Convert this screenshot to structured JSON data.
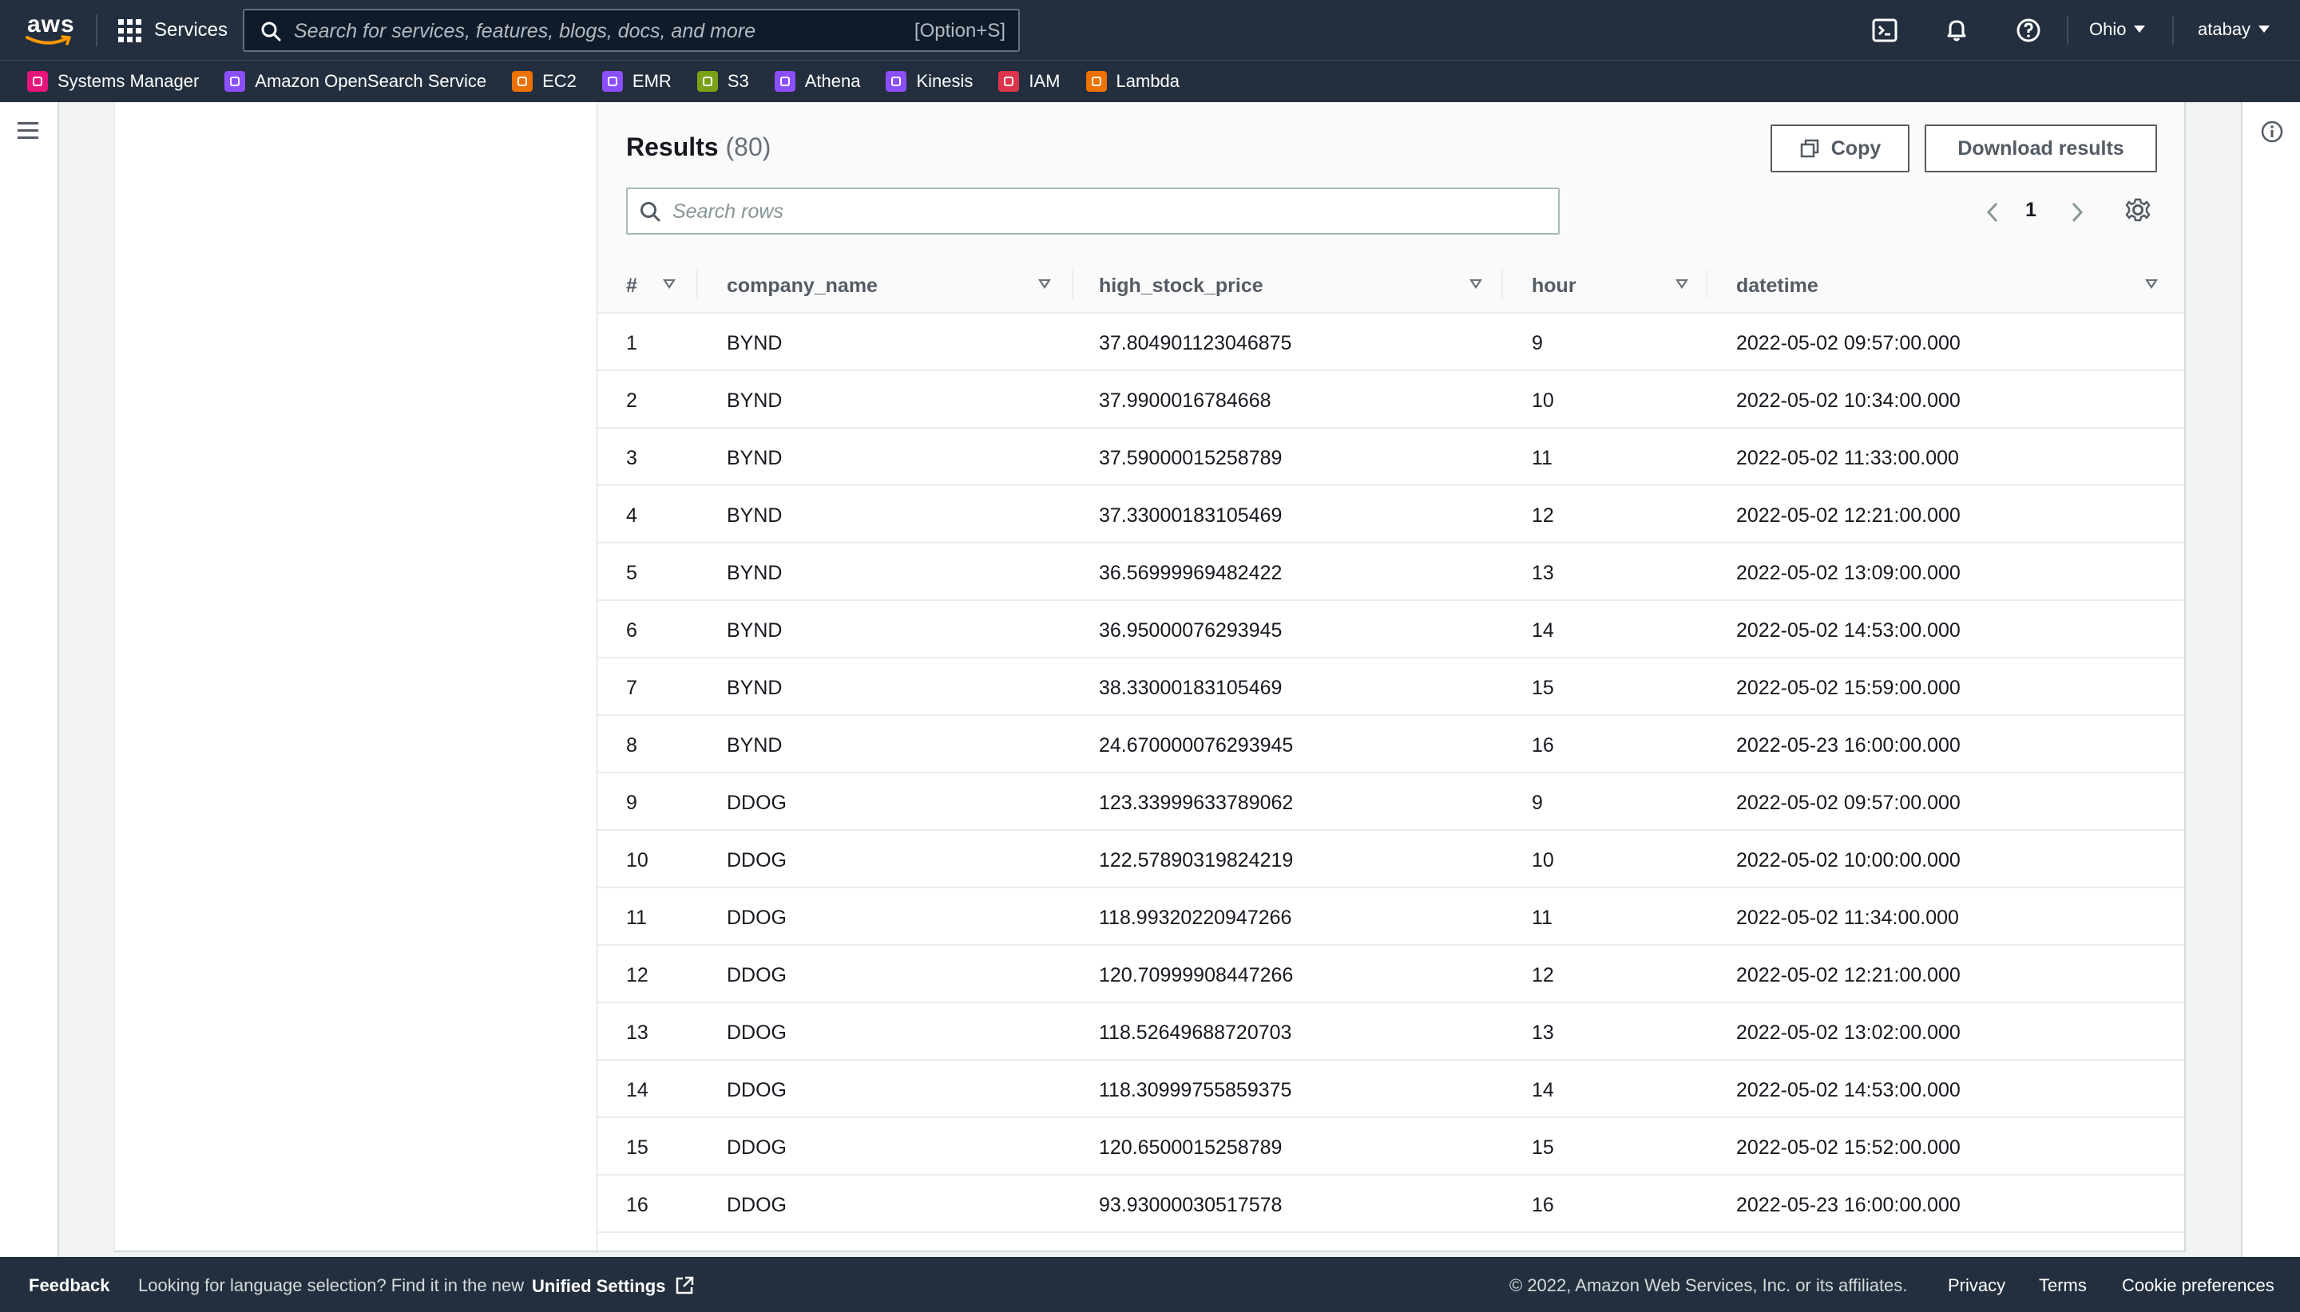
{
  "nav": {
    "logo_text": "aws",
    "services_label": "Services",
    "search_placeholder": "Search for services, features, blogs, docs, and more",
    "search_shortcut": "[Option+S]",
    "region": "Ohio",
    "user": "atabay"
  },
  "favorites": [
    {
      "label": "Systems Manager",
      "color": "#e7157b"
    },
    {
      "label": "Amazon OpenSearch Service",
      "color": "#8c4fff"
    },
    {
      "label": "EC2",
      "color": "#ed7100"
    },
    {
      "label": "EMR",
      "color": "#8c4fff"
    },
    {
      "label": "S3",
      "color": "#7aa116"
    },
    {
      "label": "Athena",
      "color": "#8c4fff"
    },
    {
      "label": "Kinesis",
      "color": "#8c4fff"
    },
    {
      "label": "IAM",
      "color": "#dd344c"
    },
    {
      "label": "Lambda",
      "color": "#ed7100"
    }
  ],
  "results": {
    "title": "Results",
    "count": "(80)",
    "copy_label": "Copy",
    "download_label": "Download results",
    "search_placeholder": "Search rows",
    "page": "1",
    "columns": [
      "#",
      "company_name",
      "high_stock_price",
      "hour",
      "datetime"
    ],
    "rows": [
      [
        "1",
        "BYND",
        "37.804901123046875",
        "9",
        "2022-05-02 09:57:00.000"
      ],
      [
        "2",
        "BYND",
        "37.9900016784668",
        "10",
        "2022-05-02 10:34:00.000"
      ],
      [
        "3",
        "BYND",
        "37.59000015258789",
        "11",
        "2022-05-02 11:33:00.000"
      ],
      [
        "4",
        "BYND",
        "37.33000183105469",
        "12",
        "2022-05-02 12:21:00.000"
      ],
      [
        "5",
        "BYND",
        "36.56999969482422",
        "13",
        "2022-05-02 13:09:00.000"
      ],
      [
        "6",
        "BYND",
        "36.95000076293945",
        "14",
        "2022-05-02 14:53:00.000"
      ],
      [
        "7",
        "BYND",
        "38.33000183105469",
        "15",
        "2022-05-02 15:59:00.000"
      ],
      [
        "8",
        "BYND",
        "24.670000076293945",
        "16",
        "2022-05-23 16:00:00.000"
      ],
      [
        "9",
        "DDOG",
        "123.33999633789062",
        "9",
        "2022-05-02 09:57:00.000"
      ],
      [
        "10",
        "DDOG",
        "122.57890319824219",
        "10",
        "2022-05-02 10:00:00.000"
      ],
      [
        "11",
        "DDOG",
        "118.99320220947266",
        "11",
        "2022-05-02 11:34:00.000"
      ],
      [
        "12",
        "DDOG",
        "120.70999908447266",
        "12",
        "2022-05-02 12:21:00.000"
      ],
      [
        "13",
        "DDOG",
        "118.52649688720703",
        "13",
        "2022-05-02 13:02:00.000"
      ],
      [
        "14",
        "DDOG",
        "118.30999755859375",
        "14",
        "2022-05-02 14:53:00.000"
      ],
      [
        "15",
        "DDOG",
        "120.6500015258789",
        "15",
        "2022-05-02 15:52:00.000"
      ],
      [
        "16",
        "DDOG",
        "93.93000030517578",
        "16",
        "2022-05-23 16:00:00.000"
      ]
    ]
  },
  "footer": {
    "feedback": "Feedback",
    "language_msg": "Looking for language selection? Find it in the new",
    "unified_settings": "Unified Settings",
    "copyright": "© 2022, Amazon Web Services, Inc. or its affiliates.",
    "privacy": "Privacy",
    "terms": "Terms",
    "cookie": "Cookie preferences"
  }
}
